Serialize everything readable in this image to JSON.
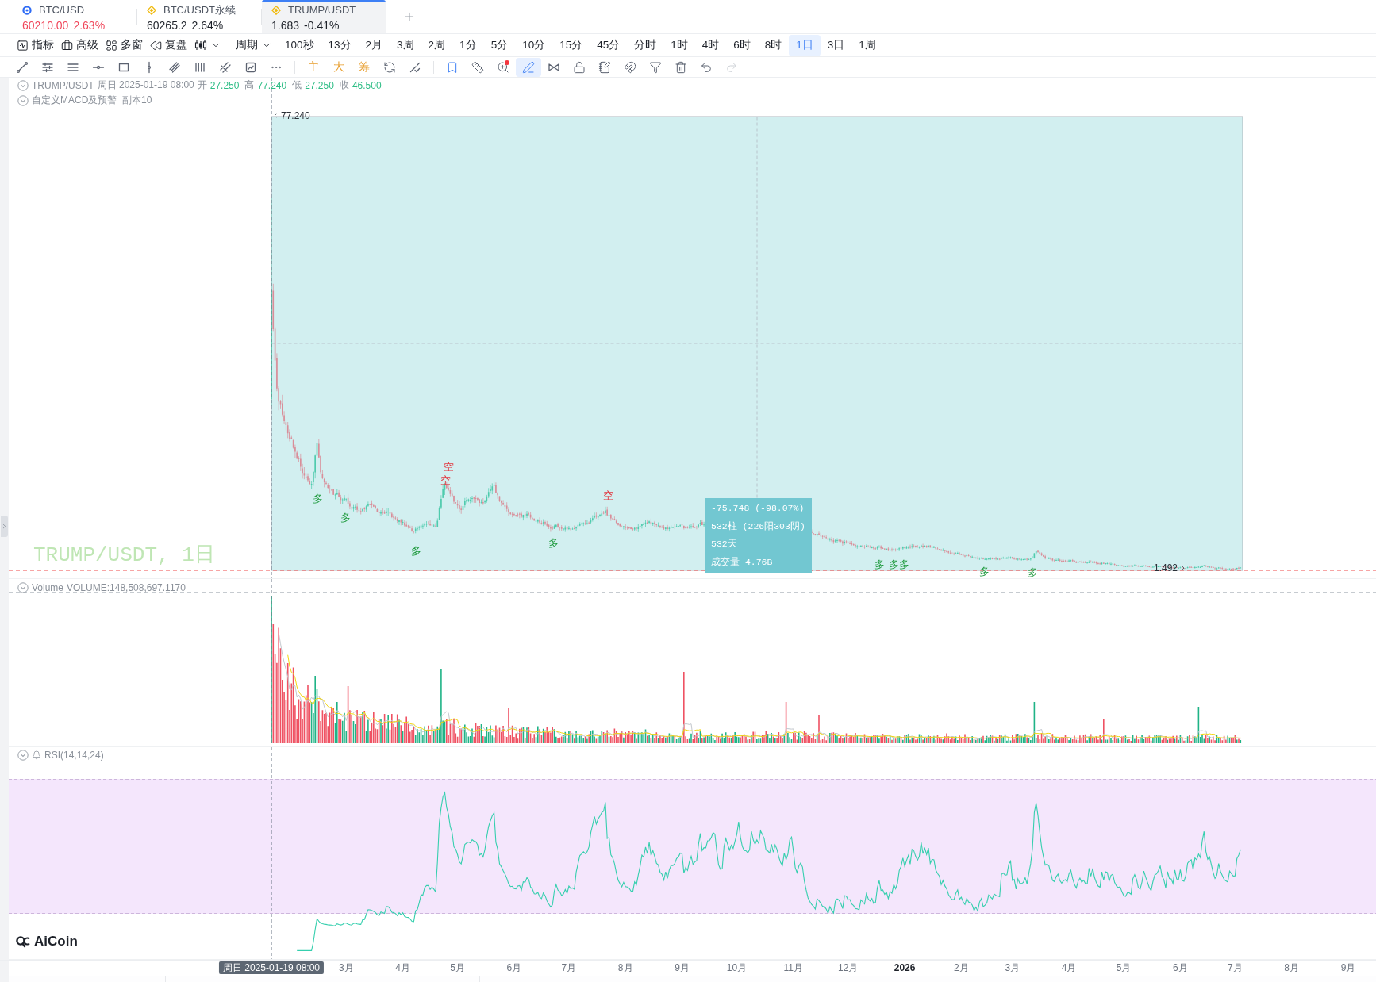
{
  "tabs": [
    {
      "kind": "circle",
      "symbol": "BTC/USD",
      "price": "60210.00",
      "change": "2.63%",
      "color": "#f0465a",
      "selected": false
    },
    {
      "kind": "diamond",
      "symbol": "BTC/USDT永续",
      "price": "60265.2",
      "change": "2.64%",
      "color": "#1d2129",
      "selected": false
    },
    {
      "kind": "diamond",
      "symbol": "TRUMP/USDT",
      "price": "1.683",
      "change": "-0.41%",
      "color": "#1d2129",
      "selected": true
    }
  ],
  "toolbar": {
    "buttons": [
      {
        "kind": "indicators",
        "label": "指标"
      },
      {
        "kind": "advanced",
        "label": "高级"
      },
      {
        "kind": "windows",
        "label": "多窗"
      },
      {
        "kind": "replay",
        "label": "复盘"
      }
    ],
    "period_menu": "周期",
    "periods": [
      {
        "label": "100秒",
        "selected": false
      },
      {
        "label": "13分",
        "selected": false
      },
      {
        "label": "2月",
        "selected": false
      },
      {
        "label": "3周",
        "selected": false
      },
      {
        "label": "2周",
        "selected": false
      },
      {
        "label": "1分",
        "selected": false
      },
      {
        "label": "5分",
        "selected": false
      },
      {
        "label": "10分",
        "selected": false
      },
      {
        "label": "15分",
        "selected": false
      },
      {
        "label": "45分",
        "selected": false
      },
      {
        "label": "分时",
        "selected": false
      },
      {
        "label": "1时",
        "selected": false
      },
      {
        "label": "4时",
        "selected": false
      },
      {
        "label": "6时",
        "selected": false
      },
      {
        "label": "8时",
        "selected": false
      },
      {
        "label": "1日",
        "selected": true
      },
      {
        "label": "3日",
        "selected": false
      },
      {
        "label": "1周",
        "selected": false
      }
    ]
  },
  "drawing_toolbar": {
    "shape_tools": [
      {
        "kind": "trendline"
      },
      {
        "kind": "levels"
      },
      {
        "kind": "lines"
      },
      {
        "kind": "hline"
      },
      {
        "kind": "rect"
      },
      {
        "kind": "vline"
      },
      {
        "kind": "channel"
      },
      {
        "kind": "bars"
      },
      {
        "kind": "cross"
      },
      {
        "kind": "frame"
      },
      {
        "kind": "more"
      }
    ],
    "mark_tools": [
      {
        "label": "主"
      },
      {
        "label": "大"
      },
      {
        "label": "筹"
      }
    ],
    "extra_tools": [
      {
        "kind": "swap"
      },
      {
        "kind": "split"
      }
    ],
    "edit_tools": [
      {
        "kind": "bookmark",
        "selected": false,
        "disabled": false,
        "notified": false
      },
      {
        "kind": "ruler",
        "selected": false,
        "disabled": false,
        "notified": false
      },
      {
        "kind": "zoom",
        "selected": false,
        "disabled": false,
        "notified": true
      },
      {
        "kind": "pen",
        "selected": true,
        "disabled": false,
        "notified": false
      },
      {
        "kind": "bowtie",
        "selected": false,
        "disabled": false,
        "notified": false
      },
      {
        "kind": "unlock",
        "selected": false,
        "disabled": false,
        "notified": false
      },
      {
        "kind": "note",
        "selected": false,
        "disabled": false,
        "notified": false
      },
      {
        "kind": "magnet",
        "selected": false,
        "disabled": false,
        "notified": false
      },
      {
        "kind": "filter",
        "selected": false,
        "disabled": false,
        "notified": false
      },
      {
        "kind": "trash",
        "selected": false,
        "disabled": false,
        "notified": false
      },
      {
        "kind": "undo",
        "selected": false,
        "disabled": false,
        "notified": false
      },
      {
        "kind": "redo",
        "selected": false,
        "disabled": true,
        "notified": false
      }
    ]
  },
  "legend": {
    "symbol": "TRUMP/USDT",
    "time": "周日 2025-01-19 08:00",
    "fields": [
      {
        "label": "开",
        "value": "27.250"
      },
      {
        "label": "高",
        "value": "77.240"
      },
      {
        "label": "低",
        "value": "27.250"
      },
      {
        "label": "收",
        "value": "46.500"
      }
    ],
    "indicator": "自定义MACD及预警_副本10"
  },
  "main_chart": {
    "label": "TRUMP/USDT, 1日",
    "range_high": "77.240",
    "range_low": "1.492",
    "measure": [
      "-75.748 (-98.07%)",
      "532柱 (226阳303阴)",
      "532天",
      "成交量 4.76B"
    ],
    "signals": [
      {
        "kind": "long",
        "label": "多"
      },
      {
        "kind": "long",
        "label": "多"
      },
      {
        "kind": "long",
        "label": "多"
      },
      {
        "kind": "short",
        "label": "空"
      },
      {
        "kind": "short",
        "label": "空"
      },
      {
        "kind": "long",
        "label": "多"
      },
      {
        "kind": "short",
        "label": "空"
      },
      {
        "kind": "long",
        "label": "多"
      },
      {
        "kind": "long",
        "label": "多"
      },
      {
        "kind": "long",
        "label": "多"
      },
      {
        "kind": "long",
        "label": "多"
      },
      {
        "kind": "long",
        "label": "多"
      }
    ]
  },
  "volume_pane": {
    "title": "Volume",
    "reading": "VOLUME:148,508,697.1170"
  },
  "rsi_pane": {
    "title": "RSI(14,14,24)"
  },
  "logo": "AiCoin",
  "time_axis": {
    "cursor": "周日 2025-01-19 08:00",
    "labels": [
      {
        "text": "3月",
        "kind": "month"
      },
      {
        "text": "4月",
        "kind": "month"
      },
      {
        "text": "5月",
        "kind": "month"
      },
      {
        "text": "6月",
        "kind": "month"
      },
      {
        "text": "7月",
        "kind": "month"
      },
      {
        "text": "8月",
        "kind": "month"
      },
      {
        "text": "9月",
        "kind": "month"
      },
      {
        "text": "10月",
        "kind": "month"
      },
      {
        "text": "11月",
        "kind": "month"
      },
      {
        "text": "12月",
        "kind": "month"
      },
      {
        "text": "2026",
        "kind": "year"
      },
      {
        "text": "2月",
        "kind": "month"
      },
      {
        "text": "3月",
        "kind": "month"
      },
      {
        "text": "4月",
        "kind": "month"
      },
      {
        "text": "5月",
        "kind": "month"
      },
      {
        "text": "6月",
        "kind": "month"
      },
      {
        "text": "7月",
        "kind": "month"
      },
      {
        "text": "8月",
        "kind": "month"
      },
      {
        "text": "9月",
        "kind": "month"
      }
    ]
  }
}
